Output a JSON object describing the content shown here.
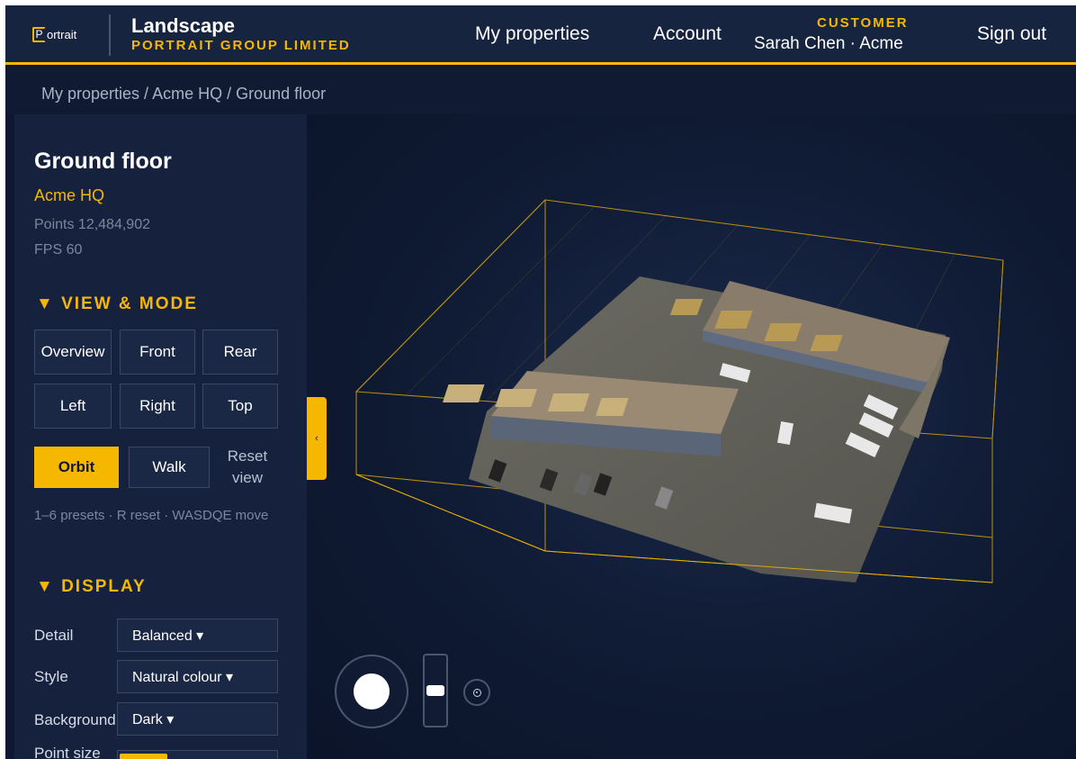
{
  "header": {
    "logo_text": "ortrait",
    "logo_mark": "P",
    "app_title": "Landscape",
    "company": "PORTRAIT GROUP LIMITED",
    "nav": {
      "properties": "My properties",
      "account": "Account",
      "sign_out": "Sign out"
    },
    "customer_label": "CUSTOMER",
    "customer_name": "Sarah Chen · Acme"
  },
  "breadcrumb": {
    "items": [
      "My properties",
      "Acme HQ",
      "Ground floor"
    ],
    "separator": " / "
  },
  "sidebar": {
    "title": "Ground floor",
    "property": "Acme HQ",
    "points": "Points 12,484,902",
    "fps": "FPS 60",
    "view_mode": {
      "heading": "▼ VIEW & MODE",
      "presets": [
        "Overview",
        "Front",
        "Rear",
        "Left",
        "Right",
        "Top"
      ],
      "modes": {
        "orbit": "Orbit",
        "walk": "Walk",
        "reset": "Reset view"
      },
      "active_mode": "Orbit",
      "hint": "1–6 presets · R reset · WASDQE move"
    },
    "display": {
      "heading": "▼ DISPLAY",
      "detail_label": "Detail",
      "detail_value": "Balanced ▾",
      "style_label": "Style",
      "style_value": "Natural colour ▾",
      "background_label": "Background",
      "background_value": "Dark ▾",
      "point_size_label": "Point size",
      "point_size_fraction": 0.3
    }
  },
  "viewer": {
    "collapse_icon": "‹",
    "accent_color": "#f5b700"
  }
}
